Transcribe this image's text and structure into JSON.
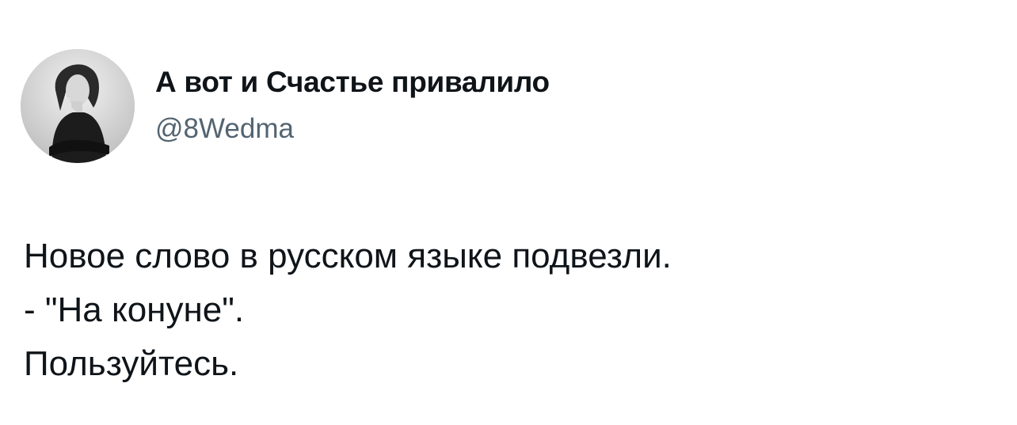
{
  "author": {
    "display_name": "А вот и Счастье привалило",
    "handle": "@8Wedma",
    "avatar": "avatar-photo-woman"
  },
  "tweet": {
    "lines": [
      "Новое слово в русском языке подвезли.",
      "- \"На конуне\".",
      "Пользуйтесь."
    ]
  },
  "colors": {
    "text": "#0f1419",
    "secondary_text": "#536471",
    "background": "#ffffff"
  }
}
